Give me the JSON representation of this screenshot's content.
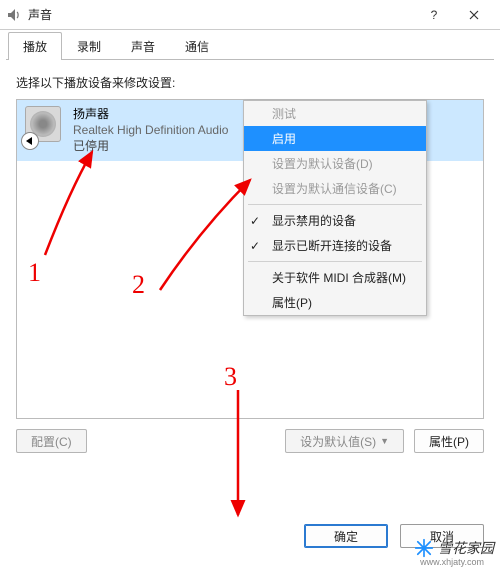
{
  "window": {
    "title": "声音"
  },
  "tabs": [
    {
      "label": "播放",
      "active": true
    },
    {
      "label": "录制",
      "active": false
    },
    {
      "label": "声音",
      "active": false
    },
    {
      "label": "通信",
      "active": false
    }
  ],
  "instruction": "选择以下播放设备来修改设置:",
  "device": {
    "title": "扬声器",
    "subtitle": "Realtek High Definition Audio",
    "status": "已停用"
  },
  "context_menu": [
    {
      "kind": "item",
      "label": "测试",
      "disabled": true
    },
    {
      "kind": "item",
      "label": "启用",
      "highlight": true
    },
    {
      "kind": "item",
      "label": "设置为默认设备(D)",
      "disabled": true
    },
    {
      "kind": "item",
      "label": "设置为默认通信设备(C)",
      "disabled": true
    },
    {
      "kind": "sep"
    },
    {
      "kind": "item",
      "label": "显示禁用的设备",
      "checked": true
    },
    {
      "kind": "item",
      "label": "显示已断开连接的设备",
      "checked": true
    },
    {
      "kind": "sep"
    },
    {
      "kind": "item",
      "label": "关于软件 MIDI 合成器(M)"
    },
    {
      "kind": "item",
      "label": "属性(P)"
    }
  ],
  "footer_buttons": {
    "configure": "配置(C)",
    "set_default": "设为默认值(S)",
    "properties": "属性(P)"
  },
  "dialog_buttons": {
    "ok": "确定",
    "cancel": "取消"
  },
  "annotations": {
    "l1": "1",
    "l2": "2",
    "l3": "3"
  },
  "watermark": {
    "brand": "雪花家园",
    "url": "www.xhjaty.com"
  }
}
